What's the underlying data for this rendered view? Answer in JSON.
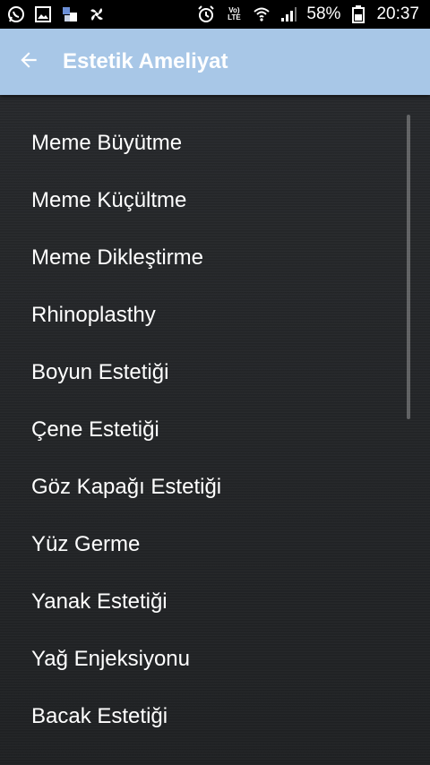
{
  "status_bar": {
    "left_icons": [
      "whatsapp-icon",
      "image-icon",
      "news-icon",
      "fan-icon"
    ],
    "right_icons": [
      "alarm-icon",
      "volte-icon",
      "wifi-icon",
      "signal-icon",
      "battery-icon"
    ],
    "volte_top": "Vo)",
    "volte_bottom": "LTE",
    "battery_percent": "58%",
    "time": "20:37"
  },
  "appbar": {
    "title": "Estetik Ameliyat",
    "background_color": "#a8c7e7"
  },
  "list": {
    "items": [
      {
        "label": "Meme Büyütme"
      },
      {
        "label": "Meme Küçültme"
      },
      {
        "label": "Meme Dikleştirme"
      },
      {
        "label": "Rhinoplasthy"
      },
      {
        "label": "Boyun Estetiği"
      },
      {
        "label": "Çene Estetiği"
      },
      {
        "label": "Göz Kapağı Estetiği"
      },
      {
        "label": "Yüz Germe"
      },
      {
        "label": "Yanak Estetiği"
      },
      {
        "label": "Yağ Enjeksiyonu"
      },
      {
        "label": "Bacak Estetiği"
      }
    ]
  }
}
